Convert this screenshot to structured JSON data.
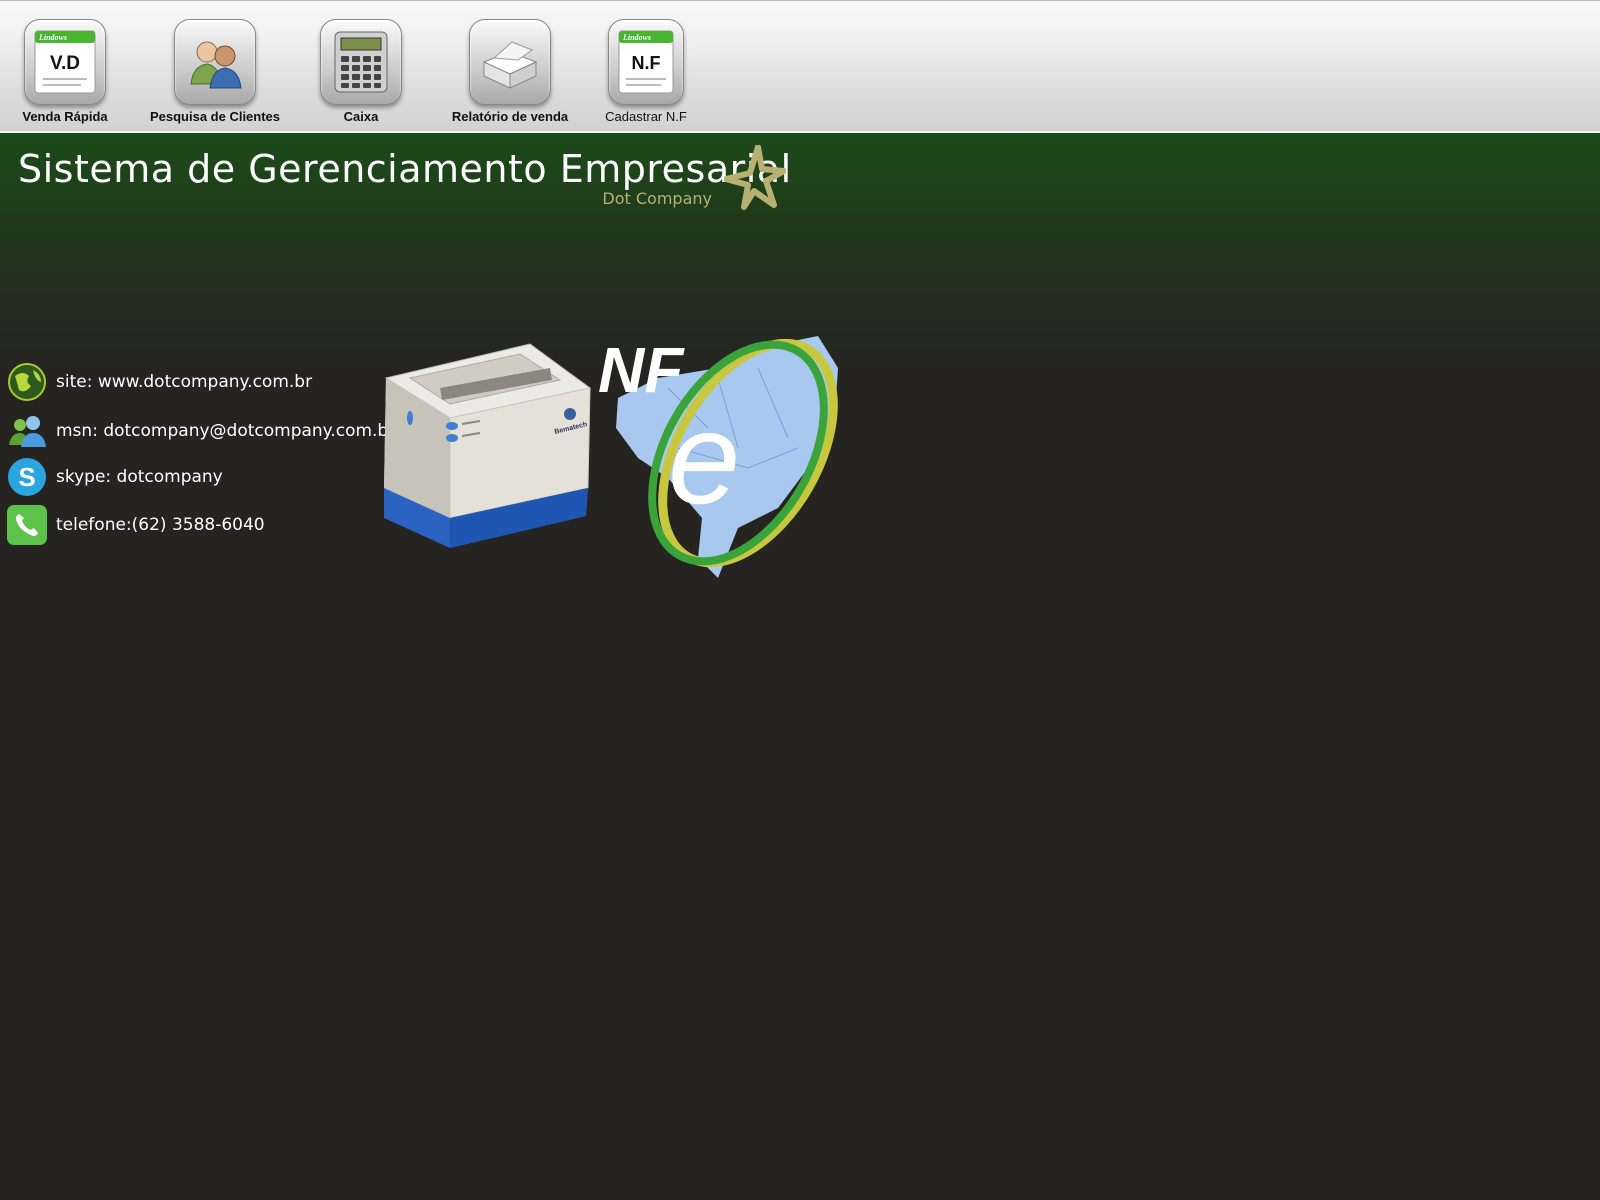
{
  "toolbar": {
    "items": [
      {
        "label": "Venda Rápida",
        "icon": "quick-sale-document-icon",
        "badge": "V.D"
      },
      {
        "label": "Pesquisa de Clientes",
        "icon": "clients-people-icon"
      },
      {
        "label": "Caixa",
        "icon": "calculator-icon"
      },
      {
        "label": "Relatório de venda",
        "icon": "sales-report-box-icon"
      },
      {
        "label": "Cadastrar N.F",
        "icon": "invoice-document-icon",
        "badge": "N.F"
      }
    ],
    "doc_brand": "Lindows"
  },
  "header": {
    "title": "Sistema de Gerenciamento Empresarial",
    "subtitle": "Dot Company",
    "logo": "star-logo-icon"
  },
  "contacts": [
    {
      "icon": "globe-icon",
      "text": "site: www.dotcompany.com.br"
    },
    {
      "icon": "msn-icon",
      "text": "msn: dotcompany@dotcompany.com.br"
    },
    {
      "icon": "skype-icon",
      "text": "skype: dotcompany"
    },
    {
      "icon": "phone-icon",
      "text": "telefone:(62) 3588-6040"
    }
  ],
  "images": {
    "printer": {
      "icon": "fiscal-printer-image",
      "brand_text": "Bematech"
    },
    "nfe": {
      "icon": "nfe-logo-image",
      "title": "NF",
      "letter": "e"
    }
  },
  "colors": {
    "accent_gold": "#b7b073",
    "header_green": "#1c4b19",
    "background": "#252421"
  }
}
